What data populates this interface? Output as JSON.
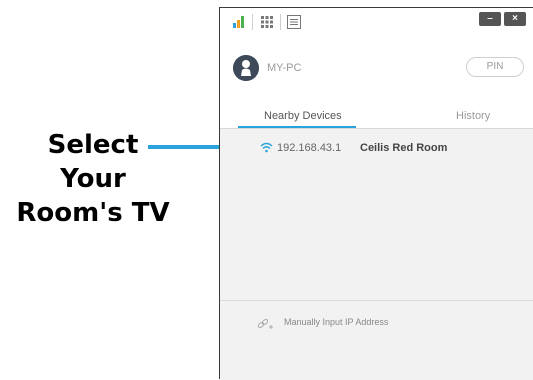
{
  "annotation": {
    "lines": [
      "Select",
      "Your",
      "Room's TV"
    ],
    "arrow_color": "#29a3db"
  },
  "window": {
    "titlebar_icons": [
      "signal-app-icon",
      "grid-icon",
      "menu-icon"
    ],
    "minimize_label": "–",
    "close_label": "×",
    "pc_name": "MY-PC",
    "pin_label": "PIN",
    "tabs": [
      {
        "label": "Nearby Devices",
        "active": true
      },
      {
        "label": "History",
        "active": false
      }
    ],
    "accent": "#29a3db",
    "devices": [
      {
        "ip": "192.168.43.1",
        "name": "Ceilis Red Room",
        "icon": "wifi-icon"
      }
    ],
    "manual_input_label": "Manually Input IP Address"
  }
}
